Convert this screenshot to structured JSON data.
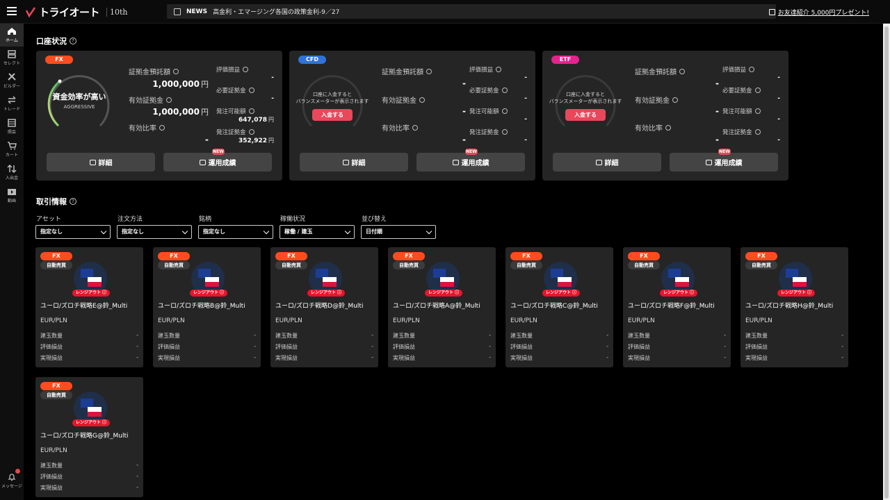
{
  "header": {
    "logo_text": "トライオート",
    "logo_badge": "10th",
    "news_label": "NEWS",
    "news_text": "高金利・エマージング各国の政策金利-9／27",
    "referral": "お友達紹介 5,000円プレゼント!"
  },
  "sidebar": {
    "items": [
      {
        "label": "ホーム",
        "icon": "home-icon"
      },
      {
        "label": "セレクト",
        "icon": "select-icon"
      },
      {
        "label": "ビルダー",
        "icon": "builder-icon"
      },
      {
        "label": "トレード",
        "icon": "trade-icon"
      },
      {
        "label": "照会",
        "icon": "inquiry-icon"
      },
      {
        "label": "カート",
        "icon": "cart-icon"
      },
      {
        "label": "入出金",
        "icon": "transfer-icon"
      },
      {
        "label": "動画",
        "icon": "video-icon"
      }
    ],
    "message": "メッセージ"
  },
  "account": {
    "title": "口座状況",
    "labels": {
      "deposit": "証拠金預託額",
      "effective": "有効証拠金",
      "ratio": "有効比率",
      "pl": "評価損益",
      "required": "必要証拠金",
      "available": "発注可能額",
      "order_margin": "発注証拠金"
    },
    "yen": "円",
    "dash": "-",
    "details_btn": "詳細",
    "performance_btn": "運用成績",
    "new_badge": "NEW",
    "fx": {
      "tag": "FX",
      "gauge_main": "資金効率が高い",
      "gauge_sub": "AGGRESSIVE",
      "deposit": "1,000,000",
      "effective": "1,000,000",
      "available": "647,078",
      "order_margin": "352,922"
    },
    "cfd": {
      "tag": "CFD",
      "gauge_msg1": "口座に入金すると",
      "gauge_msg2": "バランスメーターが表示されます",
      "deposit_btn": "入金する"
    },
    "etf": {
      "tag": "ETF",
      "gauge_msg1": "口座に入金すると",
      "gauge_msg2": "バランスメーターが表示されます",
      "deposit_btn": "入金する"
    }
  },
  "trade": {
    "title": "取引情報",
    "filters": [
      {
        "label": "アセット",
        "value": "指定なし"
      },
      {
        "label": "注文方法",
        "value": "指定なし"
      },
      {
        "label": "銘柄",
        "value": "指定なし"
      },
      {
        "label": "稼働状況",
        "value": "稼働 / 建玉"
      },
      {
        "label": "並び替え",
        "value": "日付順"
      }
    ],
    "card_common": {
      "asset": "FX",
      "mode": "自動売買",
      "status": "レンジアウト",
      "pair": "EUR/PLN",
      "row1": "建玉数量",
      "row2": "評価損益",
      "row3": "実現損益",
      "dash": "-"
    },
    "strategies": [
      "ユーロ/ズロチ戦略E@鈴_Multi",
      "ユーロ/ズロチ戦略B@鈴_Multi",
      "ユーロ/ズロチ戦略D@鈴_Multi",
      "ユーロ/ズロチ戦略A@鈴_Multi",
      "ユーロ/ズロチ戦略C@鈴_Multi",
      "ユーロ/ズロチ戦略F@鈴_Multi",
      "ユーロ/ズロチ戦略H@鈴_Multi",
      "ユーロ/ズロチ戦略G@鈴_Multi"
    ]
  },
  "colors": {
    "fx": "#ff4c1f",
    "cfd": "#2f72d8",
    "etf": "#e6228c",
    "accent_red": "#e8485a"
  }
}
